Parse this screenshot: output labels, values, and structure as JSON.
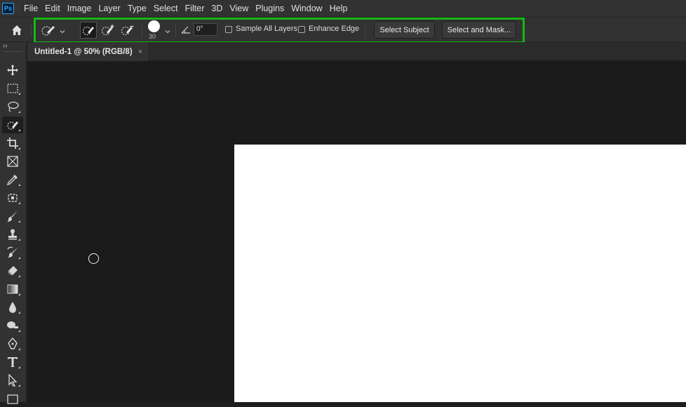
{
  "app": {
    "logo_text": "Ps"
  },
  "menu": [
    "File",
    "Edit",
    "Image",
    "Layer",
    "Type",
    "Select",
    "Filter",
    "3D",
    "View",
    "Plugins",
    "Window",
    "Help"
  ],
  "options": {
    "brush_size": "30",
    "angle_value": "0°",
    "sample_all_layers_label": "Sample All Layers",
    "sample_all_layers_checked": false,
    "enhance_edge_label": "Enhance Edge",
    "enhance_edge_checked": false,
    "select_subject_label": "Select Subject",
    "select_and_mask_label": "Select and Mask...",
    "highlight_color": "#16b816"
  },
  "document": {
    "tab_title": "Untitled-1 @ 50% (RGB/8)",
    "close_glyph": "×"
  },
  "toolbar": {
    "collapse_glyph": "››",
    "tools": [
      "move-tool",
      "marquee-tool",
      "lasso-tool",
      "quick-selection-tool",
      "crop-tool",
      "frame-tool",
      "eyedropper-tool",
      "spot-healing-tool",
      "brush-tool",
      "clone-stamp-tool",
      "history-brush-tool",
      "eraser-tool",
      "gradient-tool",
      "blur-tool",
      "dodge-tool",
      "pen-tool",
      "type-tool",
      "path-selection-tool",
      "rectangle-tool"
    ],
    "active_tool": "quick-selection-tool"
  },
  "colors": {
    "ui_bg": "#323232",
    "workspace_bg": "#1b1b1b",
    "canvas": "#ffffff",
    "accent": "#31a8ff"
  }
}
